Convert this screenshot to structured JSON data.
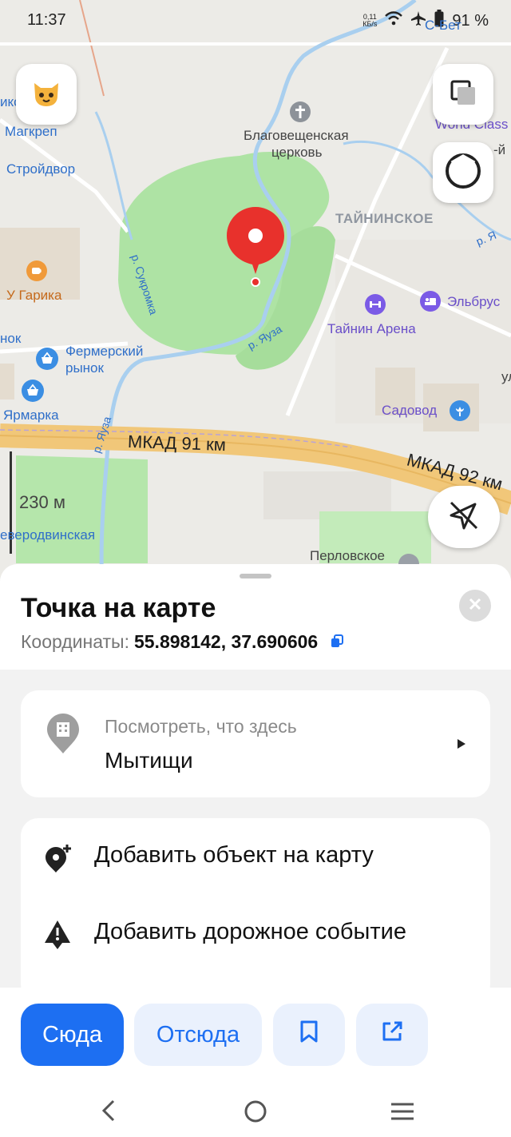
{
  "status_bar": {
    "time": "11:37",
    "net_speed": "0,11",
    "net_unit": "КБ/s",
    "battery": "91 %"
  },
  "map": {
    "labels": {
      "magkrep": "Магкреп",
      "stroydvor": "Стройдвор",
      "u_garika": "У Гарика",
      "nok": "нок",
      "fermer_1": "Фермерский",
      "fermer_2": "рынок",
      "yarmarka": "Ярмарка",
      "church_1": "Благовещенская",
      "church_2": "церковь",
      "tayninskoe": "ТАЙНИНСКОЕ",
      "elbrus": "Эльбрус",
      "taynin_arena": "Тайнин Арена",
      "sadovod": "Садовод",
      "mkad91": "МКАД 91 км",
      "mkad92": "МКАД 92 км",
      "perlovskoe": "Перловское",
      "severodvinskaya": "еверодвинская",
      "sukromka": "р. Сукромка",
      "yauza_1": "р. Яуза",
      "yauza_2": "р. Яуза",
      "world_class": "World Class",
      "s_bet": "С-Бет",
      "r_ya": "р. Я",
      "ul": "ул",
      "kiy": "-й",
      "ikso": "икс"
    },
    "scale": "230 м",
    "accent": "#e8312c"
  },
  "sheet": {
    "title": "Точка на карте",
    "coords_label": "Координаты:",
    "coords_value": "55.898142, 37.690606",
    "whats_here": {
      "caption": "Посмотреть, что здесь",
      "value": "Мытищи"
    },
    "actions": [
      {
        "label": "Добавить объект на карту"
      },
      {
        "label": "Добавить дорожное событие"
      }
    ]
  },
  "bottom_bar": {
    "to_here": "Сюда",
    "from_here": "Отсюда"
  },
  "colors": {
    "primary": "#1d6ff2",
    "secondary_bg": "#eaf1fd",
    "park": "#aee3a4",
    "road": "#f1c779"
  },
  "icons": [
    "avatar-cat-icon",
    "layers-icon",
    "compass-icon",
    "location-off-icon",
    "church-cross-icon",
    "cafe-icon",
    "basket-icon",
    "gym-icon",
    "hotel-icon",
    "flower-icon",
    "map-pin-icon",
    "copy-icon",
    "close-icon",
    "building-pin-icon",
    "play-arrow-icon",
    "add-place-icon",
    "warning-icon",
    "bookmark-icon",
    "share-icon",
    "back-icon",
    "home-icon",
    "menu-icon"
  ]
}
